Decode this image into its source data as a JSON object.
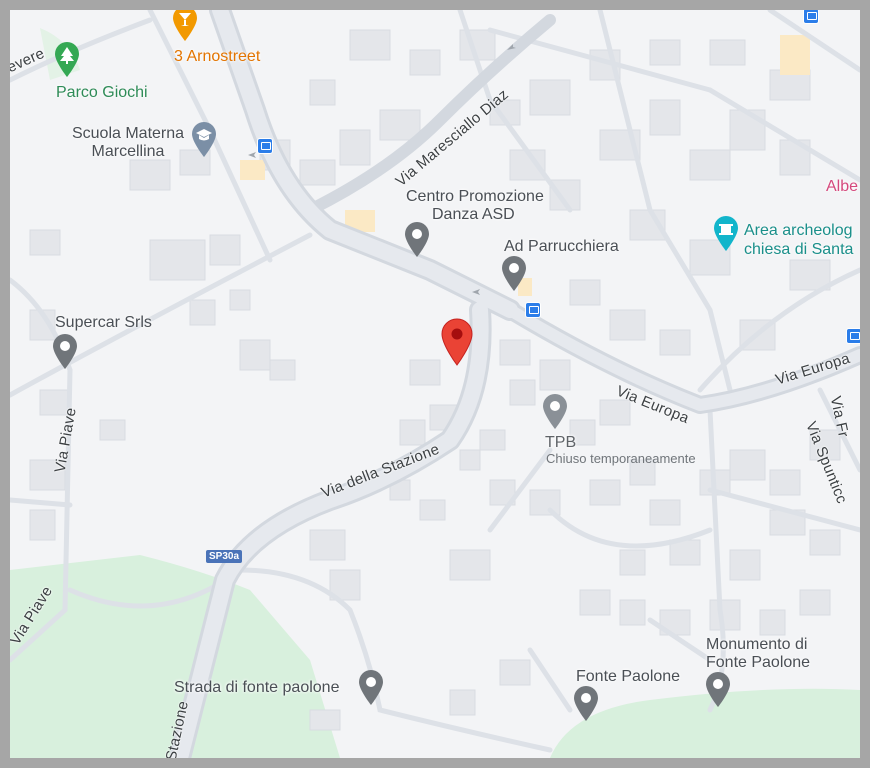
{
  "map": {
    "streets": {
      "maresciallo_diaz": "Via Maresciallo Diaz",
      "della_stazione": "Via della Stazione",
      "europa": "Via Europa",
      "europa_east": "Via Europa",
      "piave_north": "Via Piave",
      "piave_south": "Via Piave",
      "spunticchia": "Via Spunticc",
      "fr": "Via Fr",
      "stazione_south": "Stazione",
      "evere": "evere",
      "route_shield": "SP30a"
    },
    "places": {
      "parco_giochi": "Parco Giochi",
      "arnostreet": "3 Arnostreet",
      "scuola_line1": "Scuola Materna",
      "scuola_line2": "Marcellina",
      "centro_line1": "Centro Promozione",
      "centro_line2": "Danza ASD",
      "parrucchiera": "Ad Parrucchiera",
      "supercar": "Supercar Srls",
      "tpb": "TPB",
      "tpb_status": "Chiuso temporaneamente",
      "area_line1": "Area archeolog",
      "area_line2": "chiesa di Santa",
      "albe": "Albe",
      "strada_fonte": "Strada di fonte paolone",
      "fonte_paolone": "Fonte Paolone",
      "monumento_line1": "Monumento di",
      "monumento_line2": "Fonte Paolone"
    },
    "icons": {
      "selected_pin": "red-location-pin",
      "poi_pin": "grey-location-pin",
      "park": "tree-icon",
      "bar": "cocktail-icon",
      "school": "graduation-cap-icon",
      "museum": "monument-icon",
      "bus": "bus-stop-icon"
    },
    "colors": {
      "land": "#f3f4f6",
      "road": "#d5dae1",
      "park": "#d8f0dd",
      "building": "#e5e7eb",
      "selected_pin": "#ea4335",
      "poi_pin": "#70757a"
    }
  }
}
